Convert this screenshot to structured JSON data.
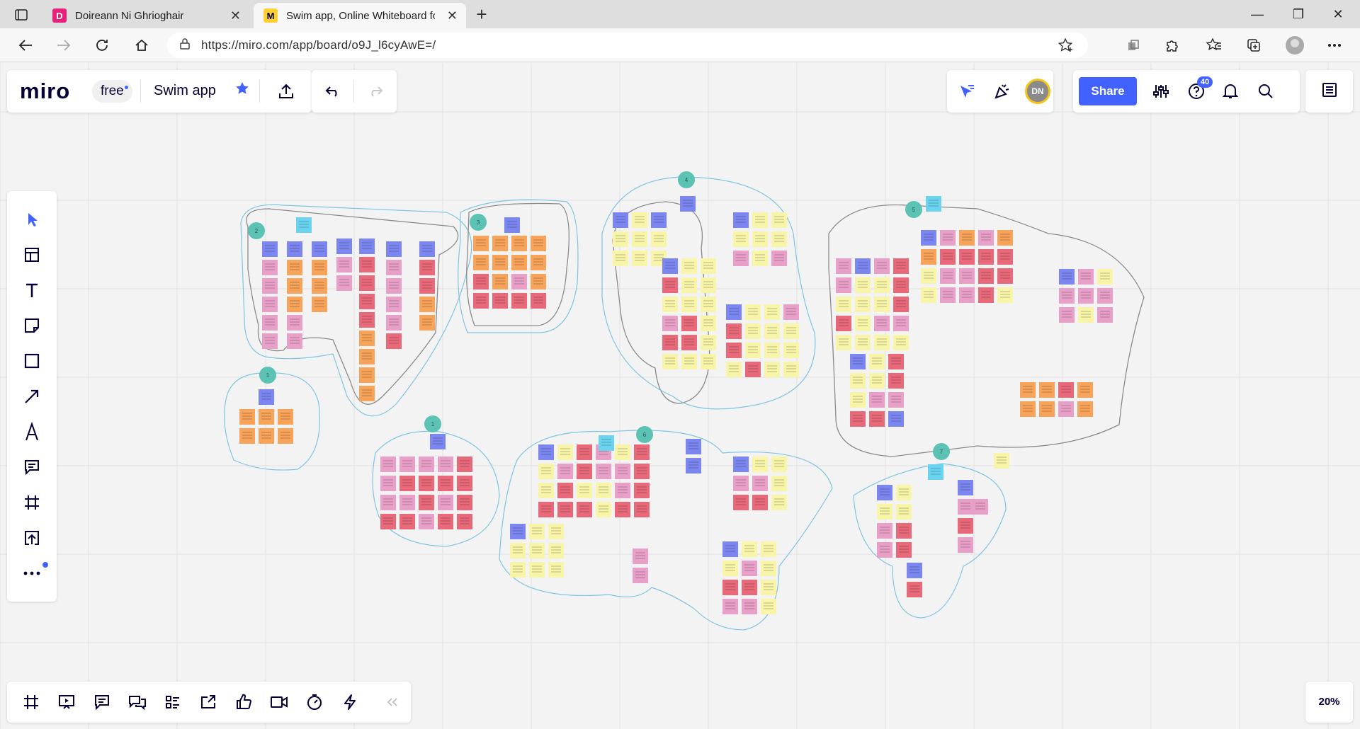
{
  "browser": {
    "tabs": [
      {
        "title": "Doireann Ni Ghrioghair",
        "favicon": "D",
        "favicon_color": "#e8207a",
        "active": false
      },
      {
        "title": "Swim app, Online Whiteboard fo",
        "favicon": "M",
        "favicon_color": "#ffd02f",
        "active": true
      }
    ],
    "url": "https://miro.com/app/board/o9J_l6cyAwE=/"
  },
  "miro": {
    "logo": "miro",
    "plan": "free",
    "board_name": "Swim app",
    "share_label": "Share",
    "help_badge": "40",
    "user_initials": "DN",
    "zoom": "20%",
    "accent": "#4262ff"
  },
  "clusters": [
    {
      "number": "2"
    },
    {
      "number": "3"
    },
    {
      "number": "4"
    },
    {
      "number": "5"
    },
    {
      "number": "1"
    },
    {
      "number": "1"
    },
    {
      "number": "6"
    },
    {
      "number": "7"
    }
  ],
  "note_colors": {
    "blue": "#7b86f0",
    "orange": "#f7a35a",
    "pink": "#e9a0c8",
    "red": "#e8697a",
    "yellow": "#f8f4a8",
    "cyan": "#6ad4f0"
  }
}
